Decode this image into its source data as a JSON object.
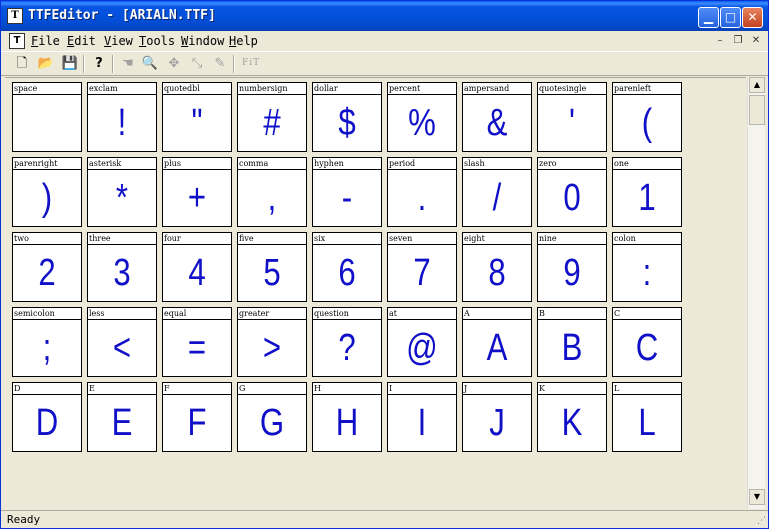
{
  "window": {
    "title": "TTFEditor - [ARIALN.TTF]",
    "app_icon": "ttf-app-icon",
    "controls": {
      "minimize": "▁",
      "maximize": "□",
      "close": "✕"
    }
  },
  "menubar": {
    "items": [
      {
        "key": "F",
        "rest": "ile"
      },
      {
        "key": "E",
        "rest": "dit"
      },
      {
        "key": "V",
        "rest": "iew"
      },
      {
        "key": "T",
        "rest": "ools"
      },
      {
        "key": "W",
        "rest": "indow"
      },
      {
        "key": "H",
        "rest": "elp"
      }
    ],
    "mdi_controls": {
      "minimize": "–",
      "restore": "❐",
      "close": "✕"
    }
  },
  "toolbar": {
    "new_icon": "🗋",
    "open_icon": "📂",
    "save_icon": "💾",
    "help_icon": "?",
    "hand_icon": "☚",
    "zoom_icon": "🔍",
    "move_icon": "✥",
    "resize_icon": "⤡",
    "pencil_icon": "✎",
    "fit_label": "FiT"
  },
  "glyphs": [
    {
      "name": "space",
      "char": " "
    },
    {
      "name": "exclam",
      "char": "!"
    },
    {
      "name": "quotedbl",
      "char": "\""
    },
    {
      "name": "numbersign",
      "char": "#"
    },
    {
      "name": "dollar",
      "char": "$"
    },
    {
      "name": "percent",
      "char": "%"
    },
    {
      "name": "ampersand",
      "char": "&"
    },
    {
      "name": "quotesingle",
      "char": "'"
    },
    {
      "name": "parenleft",
      "char": "("
    },
    {
      "name": "parenright",
      "char": ")"
    },
    {
      "name": "asterisk",
      "char": "*"
    },
    {
      "name": "plus",
      "char": "+"
    },
    {
      "name": "comma",
      "char": ","
    },
    {
      "name": "hyphen",
      "char": "-"
    },
    {
      "name": "period",
      "char": "."
    },
    {
      "name": "slash",
      "char": "/"
    },
    {
      "name": "zero",
      "char": "0"
    },
    {
      "name": "one",
      "char": "1"
    },
    {
      "name": "two",
      "char": "2"
    },
    {
      "name": "three",
      "char": "3"
    },
    {
      "name": "four",
      "char": "4"
    },
    {
      "name": "five",
      "char": "5"
    },
    {
      "name": "six",
      "char": "6"
    },
    {
      "name": "seven",
      "char": "7"
    },
    {
      "name": "eight",
      "char": "8"
    },
    {
      "name": "nine",
      "char": "9"
    },
    {
      "name": "colon",
      "char": ":"
    },
    {
      "name": "semicolon",
      "char": ";"
    },
    {
      "name": "less",
      "char": "<"
    },
    {
      "name": "equal",
      "char": "="
    },
    {
      "name": "greater",
      "char": ">"
    },
    {
      "name": "question",
      "char": "?"
    },
    {
      "name": "at",
      "char": "@"
    },
    {
      "name": "A",
      "char": "A"
    },
    {
      "name": "B",
      "char": "B"
    },
    {
      "name": "C",
      "char": "C"
    },
    {
      "name": "D",
      "char": "D"
    },
    {
      "name": "E",
      "char": "E"
    },
    {
      "name": "F",
      "char": "F"
    },
    {
      "name": "G",
      "char": "G"
    },
    {
      "name": "H",
      "char": "H"
    },
    {
      "name": "I",
      "char": "I"
    },
    {
      "name": "J",
      "char": "J"
    },
    {
      "name": "K",
      "char": "K"
    },
    {
      "name": "L",
      "char": "L"
    }
  ],
  "scrollbar": {
    "up": "▲",
    "down": "▼"
  },
  "status": {
    "text": "Ready",
    "grip": "⋰"
  },
  "colors": {
    "glyph": "#1010c8",
    "titlebar": "#0450d9"
  }
}
